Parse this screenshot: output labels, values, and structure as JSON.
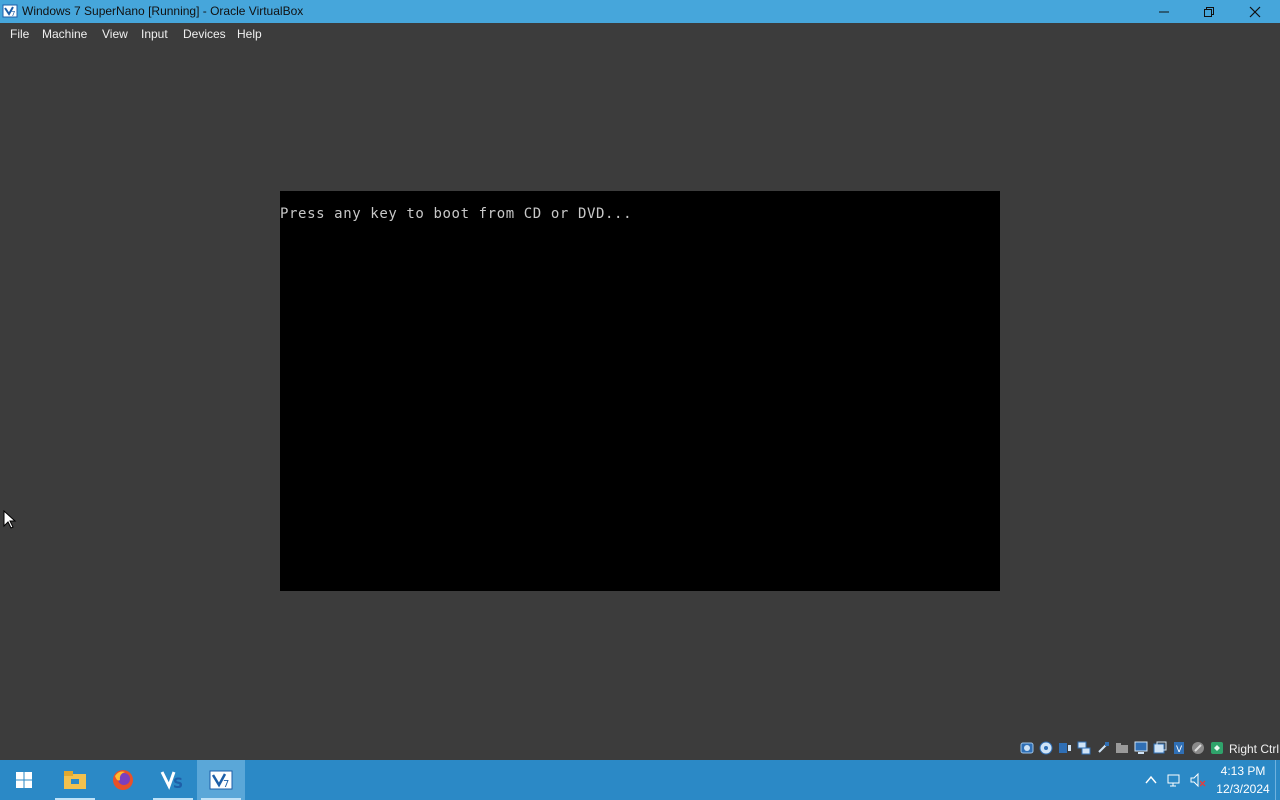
{
  "window": {
    "title": "Windows 7 SuperNano [Running] - Oracle VirtualBox"
  },
  "menu": {
    "items": [
      "File",
      "Machine",
      "View",
      "Input",
      "Devices",
      "Help"
    ]
  },
  "vm": {
    "boot_message": "Press any key to boot from CD or DVD..."
  },
  "status_bar": {
    "host_key": "Right Ctrl",
    "icons": [
      "hard-disk-icon",
      "optical-drive-icon",
      "audio-icon",
      "network-icon",
      "usb-icon",
      "shared-folders-icon",
      "display-icon",
      "recording-icon",
      "vt-x-icon",
      "mouse-integration-icon",
      "keyboard-capture-icon"
    ]
  },
  "taskbar": {
    "apps": [
      "start-icon",
      "file-explorer-icon",
      "firefox-icon",
      "visual-studio-icon",
      "virtualbox-icon"
    ],
    "time": "4:13 PM",
    "date": "12/3/2024"
  },
  "colors": {
    "titlebar": "#46a6db",
    "background": "#3c3c3c",
    "taskbar": "#2b89c6",
    "vm_screen": "#000000",
    "boot_text": "#c8c8c8"
  }
}
